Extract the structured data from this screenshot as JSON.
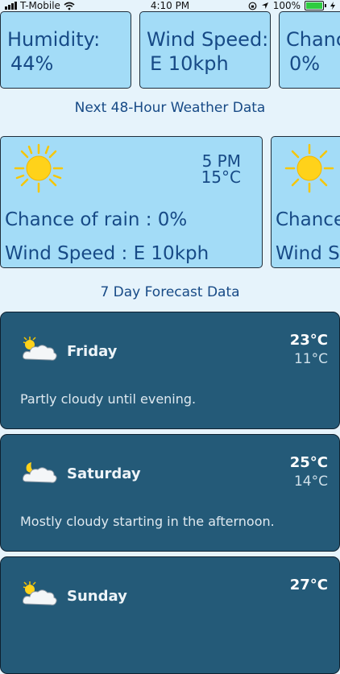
{
  "status_bar": {
    "carrier": "T-Mobile",
    "time": "4:10 PM",
    "battery": "100%",
    "icons": [
      "signal-icon",
      "wifi-icon",
      "orientation-lock-icon",
      "location-icon",
      "battery-icon",
      "charging-icon"
    ]
  },
  "metrics": [
    {
      "label": "Humidity:",
      "value": "44%"
    },
    {
      "label": "Wind Speed:",
      "value": "E 10kph"
    },
    {
      "label": "Chanc",
      "value": "0%"
    }
  ],
  "hourly_title": "Next 48-Hour Weather Data",
  "hourly": [
    {
      "time": "5 PM",
      "temp": "15°C",
      "rain": "Chance of rain : 0%",
      "wind": "Wind Speed : E 10kph",
      "icon": "sun-icon"
    },
    {
      "time": "",
      "temp": "",
      "rain": "Chance",
      "wind": "Wind Sp",
      "icon": "sun-icon"
    }
  ],
  "daily_title": "7 Day Forecast Data",
  "daily": [
    {
      "day": "Friday",
      "high": "23°C",
      "low": "11°C",
      "summary": "Partly cloudy until evening.",
      "icon": "partly-cloudy-day-icon"
    },
    {
      "day": "Saturday",
      "high": "25°C",
      "low": "14°C",
      "summary": "Mostly cloudy starting in the afternoon.",
      "icon": "partly-cloudy-night-icon"
    },
    {
      "day": "Sunday",
      "high": "27°C",
      "low": "",
      "summary": "",
      "icon": "partly-cloudy-day-icon"
    }
  ],
  "colors": {
    "background": "#e6f3fb",
    "card_light": "#a3dcf7",
    "card_dark": "#245a78",
    "text_blue": "#174a86",
    "sun": "#ffd21a"
  }
}
